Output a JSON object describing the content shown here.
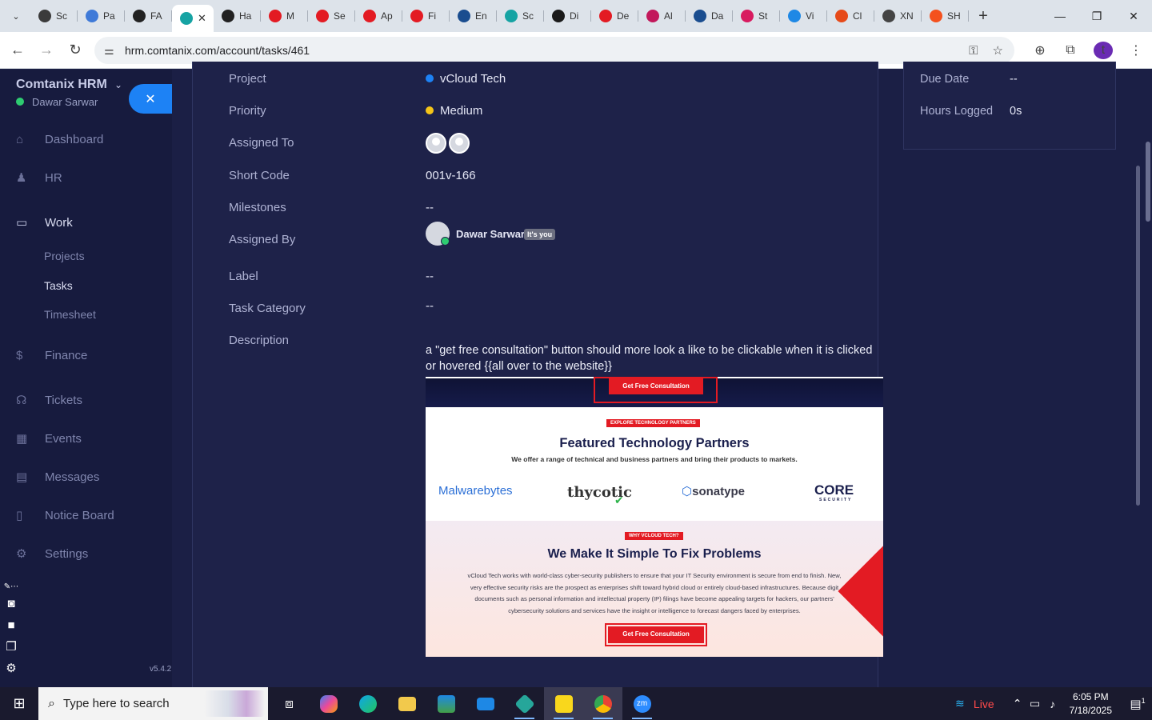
{
  "browser": {
    "tabs": [
      {
        "label": "Sc",
        "color": "#3b3b3b"
      },
      {
        "label": "Pa",
        "color": "#3f7ad8"
      },
      {
        "label": "FA",
        "color": "#222222"
      },
      {
        "label": "",
        "color": "#16a3a3",
        "active": true
      },
      {
        "label": "Ha",
        "color": "#222222"
      },
      {
        "label": "M",
        "color": "#e31b23"
      },
      {
        "label": "Se",
        "color": "#e31b23"
      },
      {
        "label": "Ap",
        "color": "#e31b23"
      },
      {
        "label": "Fi",
        "color": "#e31b23"
      },
      {
        "label": "En",
        "color": "#1a4d8f"
      },
      {
        "label": "Sc",
        "color": "#16a3a3"
      },
      {
        "label": "Di",
        "color": "#1a1a1a"
      },
      {
        "label": "De",
        "color": "#e31b23"
      },
      {
        "label": "Al",
        "color": "#c2185b"
      },
      {
        "label": "Da",
        "color": "#1a4d8f"
      },
      {
        "label": "St",
        "color": "#d81b60"
      },
      {
        "label": "Vi",
        "color": "#1e88e5"
      },
      {
        "label": "Cl",
        "color": "#e64a19"
      },
      {
        "label": "XN",
        "color": "#444444"
      },
      {
        "label": "SH",
        "color": "#f4511e"
      }
    ],
    "active_tab_close": "✕",
    "new_tab": "+",
    "url": "hrm.comtanix.com/account/tasks/461"
  },
  "sidebar": {
    "brand": "Comtanix HRM",
    "user": "Dawar Sarwar",
    "close_label": "✕",
    "items": [
      {
        "label": "Dashboard",
        "icon": "⌂"
      },
      {
        "label": "HR",
        "icon": "♟"
      },
      {
        "label": "Work",
        "icon": "▭"
      },
      {
        "label": "Finance",
        "icon": "$"
      },
      {
        "label": "Tickets",
        "icon": "☊"
      },
      {
        "label": "Events",
        "icon": "▦"
      },
      {
        "label": "Messages",
        "icon": "▤"
      },
      {
        "label": "Notice Board",
        "icon": "▯"
      },
      {
        "label": "Settings",
        "icon": "⚙"
      }
    ],
    "sub_items": [
      "Projects",
      "Tasks",
      "Timesheet"
    ],
    "version": "v5.4.2"
  },
  "task": {
    "project_label": "Project",
    "project_value": "vCloud Tech",
    "project_color": "#1d82f5",
    "priority_label": "Priority",
    "priority_value": "Medium",
    "priority_color": "#f5c518",
    "assigned_to_label": "Assigned To",
    "short_code_label": "Short Code",
    "short_code_value": "001v-166",
    "milestones_label": "Milestones",
    "milestones_value": "--",
    "assigned_by_label": "Assigned By",
    "assigned_by_name": "Dawar Sarwar",
    "its_you": "It's you",
    "label_label": "Label",
    "label_value": "--",
    "task_category_label": "Task Category",
    "task_category_value": "--",
    "description_label": "Description",
    "description_text": "a \"get free consultation\" button should more look a like to be clickable when it is clicked or hovered {{all over to the website}}"
  },
  "embedded": {
    "top_button": "Get Free Consultation",
    "pill1": "EXPLORE TECHNOLOGY PARTNERS",
    "heading1": "Featured Technology Partners",
    "sub1": "We offer a range of technical and business partners and bring their products to markets.",
    "logos": [
      "Malwarebytes",
      "thycotic",
      "sonatype",
      "CORE"
    ],
    "core_sub": "SECURITY",
    "pill2": "WHY VCLOUD TECH?",
    "heading2": "We Make It Simple To Fix Problems",
    "para_lines": [
      "vCloud Tech works with world-class cyber-security publishers to ensure that your IT Security environment is secure from end to finish. New,",
      "very effective security risks are the prospect as enterprises shift toward hybrid cloud or entirely cloud-based infrastructures. Because digit",
      "documents such as personal information and intellectual property (IP) filings have become appealing targets for hackers, our partners'",
      "cybersecurity solutions and services have the insight or intelligence to forecast dangers faced by enterprises."
    ],
    "bottom_button": "Get Free Consultation"
  },
  "right_panel": {
    "due_date_label": "Due Date",
    "due_date_value": "--",
    "hours_label": "Hours Logged",
    "hours_value": "0s"
  },
  "taskbar": {
    "search_placeholder": "Type here to search",
    "live": "Live",
    "time": "6:05 PM",
    "date": "7/18/2025",
    "notif_count": "1"
  }
}
